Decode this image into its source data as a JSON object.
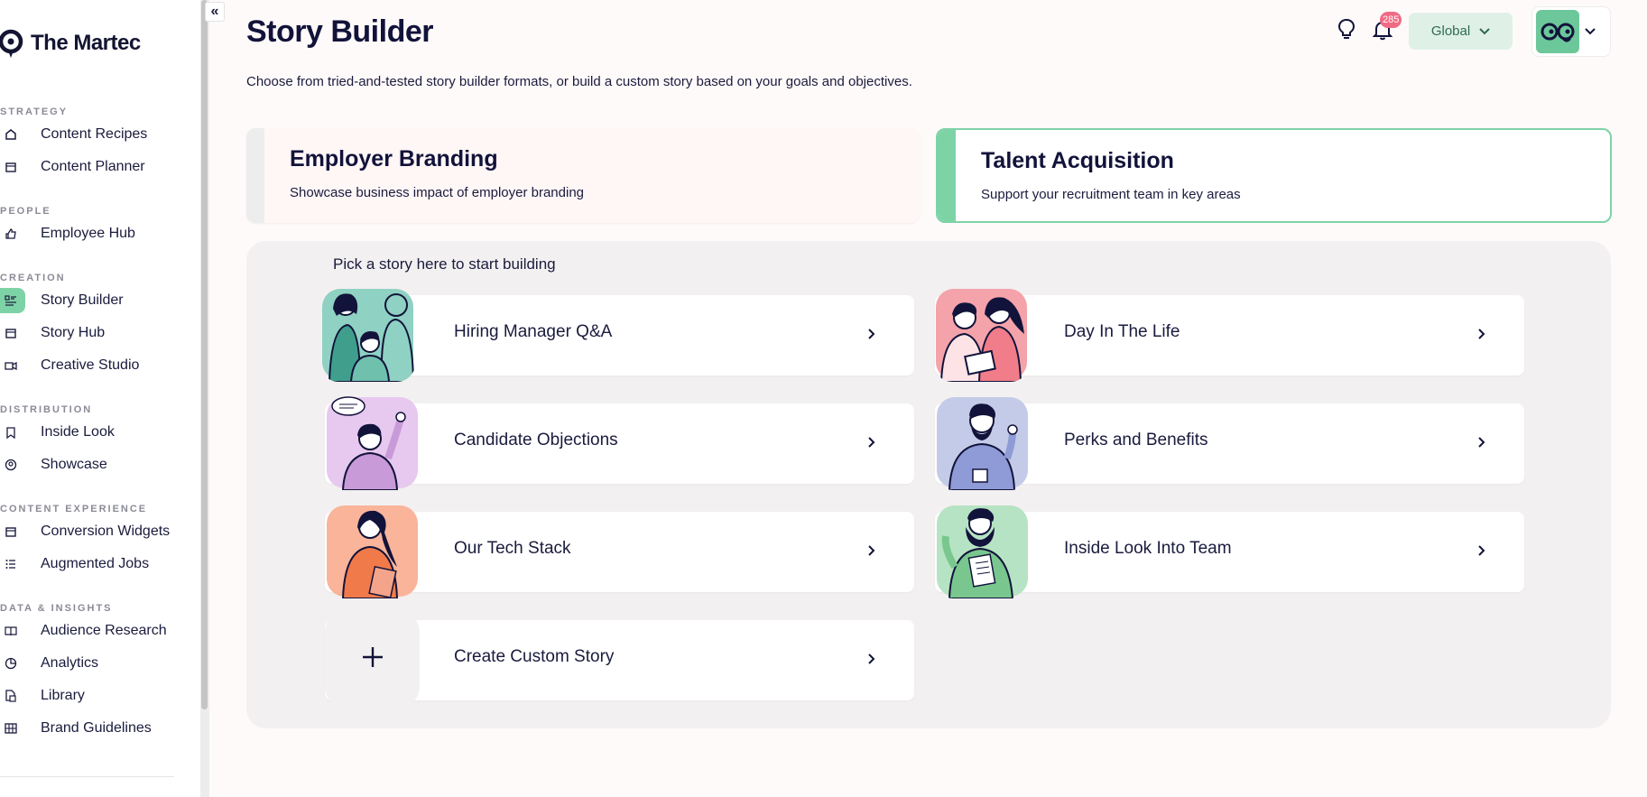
{
  "brand": {
    "name": "The Martec"
  },
  "sidebar": {
    "sections": [
      {
        "title": "STRATEGY",
        "items": [
          {
            "label": "Content Recipes",
            "icon": "home-icon"
          },
          {
            "label": "Content Planner",
            "icon": "calendar-icon"
          }
        ]
      },
      {
        "title": "PEOPLE",
        "items": [
          {
            "label": "Employee Hub",
            "icon": "thumbs-up-icon"
          }
        ]
      },
      {
        "title": "CREATION",
        "items": [
          {
            "label": "Story Builder",
            "icon": "story-builder-icon",
            "active": true
          },
          {
            "label": "Story Hub",
            "icon": "calendar-icon"
          },
          {
            "label": "Creative Studio",
            "icon": "video-icon"
          }
        ]
      },
      {
        "title": "DISTRIBUTION",
        "items": [
          {
            "label": "Inside Look",
            "icon": "bookmark-icon"
          },
          {
            "label": "Showcase",
            "icon": "user-circle-icon"
          }
        ]
      },
      {
        "title": "CONTENT EXPERIENCE",
        "items": [
          {
            "label": "Conversion Widgets",
            "icon": "calendar-icon"
          },
          {
            "label": "Augmented Jobs",
            "icon": "list-icon"
          }
        ]
      },
      {
        "title": "DATA & INSIGHTS",
        "items": [
          {
            "label": "Audience Research",
            "icon": "book-icon"
          },
          {
            "label": "Analytics",
            "icon": "pie-chart-icon"
          },
          {
            "label": "Library",
            "icon": "files-icon"
          },
          {
            "label": "Brand Guidelines",
            "icon": "grid-icon"
          }
        ]
      }
    ],
    "collapse_label": "«"
  },
  "header": {
    "title": "Story Builder",
    "description": "Choose from tried-and-tested story builder formats, or build a custom story based on your goals and objectives.",
    "notification_count": "285",
    "region": "Global"
  },
  "categories": [
    {
      "title": "Employer Branding",
      "subtitle": "Showcase business impact of employer branding",
      "selected": false
    },
    {
      "title": "Talent Acquisition",
      "subtitle": "Support your recruitment team in key areas",
      "selected": true
    }
  ],
  "stories": {
    "prompt": "Pick a story here to start building",
    "items": [
      {
        "label": "Hiring Manager Q&A",
        "color": "#8fd1c2"
      },
      {
        "label": "Day In The Life",
        "color": "#f4a3ab"
      },
      {
        "label": "Candidate Objections",
        "color": "#e7c8ef"
      },
      {
        "label": "Perks and Benefits",
        "color": "#c4cbe8"
      },
      {
        "label": "Our Tech Stack",
        "color": "#f9b49a"
      },
      {
        "label": "Inside Look Into Team",
        "color": "#b6e3c3"
      },
      {
        "label": "Create Custom Story",
        "color": "#f3f0f1"
      }
    ],
    "custom_symbol": "+"
  },
  "colors": {
    "accent": "#7ed3a6",
    "text": "#12133a",
    "badge": "#f06a83"
  }
}
